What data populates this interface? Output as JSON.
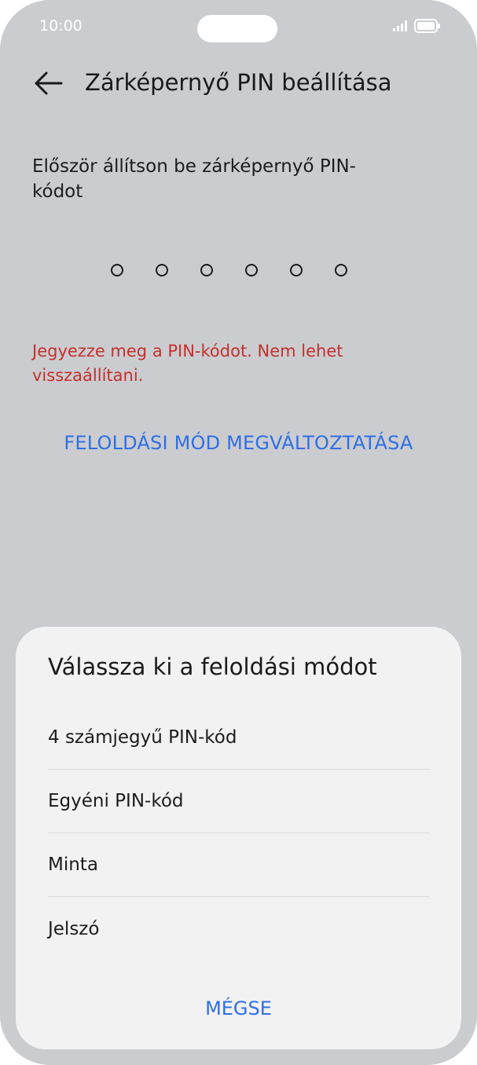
{
  "status_bar": {
    "time": "10:00",
    "icons": [
      "signal-icon",
      "battery-icon"
    ]
  },
  "header": {
    "back_icon": "arrow-left-icon",
    "title": "Zárképernyő PIN beállítása"
  },
  "main": {
    "instruction": "Először állítson be zárképernyő PIN-kódot",
    "pin_length": 6,
    "warning": "Jegyezze meg a PIN-kódot. Nem lehet visszaállítani.",
    "change_mode_label": "FELOLDÁSI MÓD MEGVÁLTOZTATÁSA"
  },
  "sheet": {
    "title": "Válassza ki a feloldási módot",
    "options": [
      {
        "label": "4 számjegyű PIN-kód"
      },
      {
        "label": "Egyéni PIN-kód"
      },
      {
        "label": "Minta"
      },
      {
        "label": "Jelszó"
      }
    ],
    "cancel_label": "MÉGSE"
  },
  "colors": {
    "accent": "#2f6fe4",
    "warning": "#c4302b",
    "background": "#cbccd0",
    "sheet": "#f2f2f3"
  }
}
